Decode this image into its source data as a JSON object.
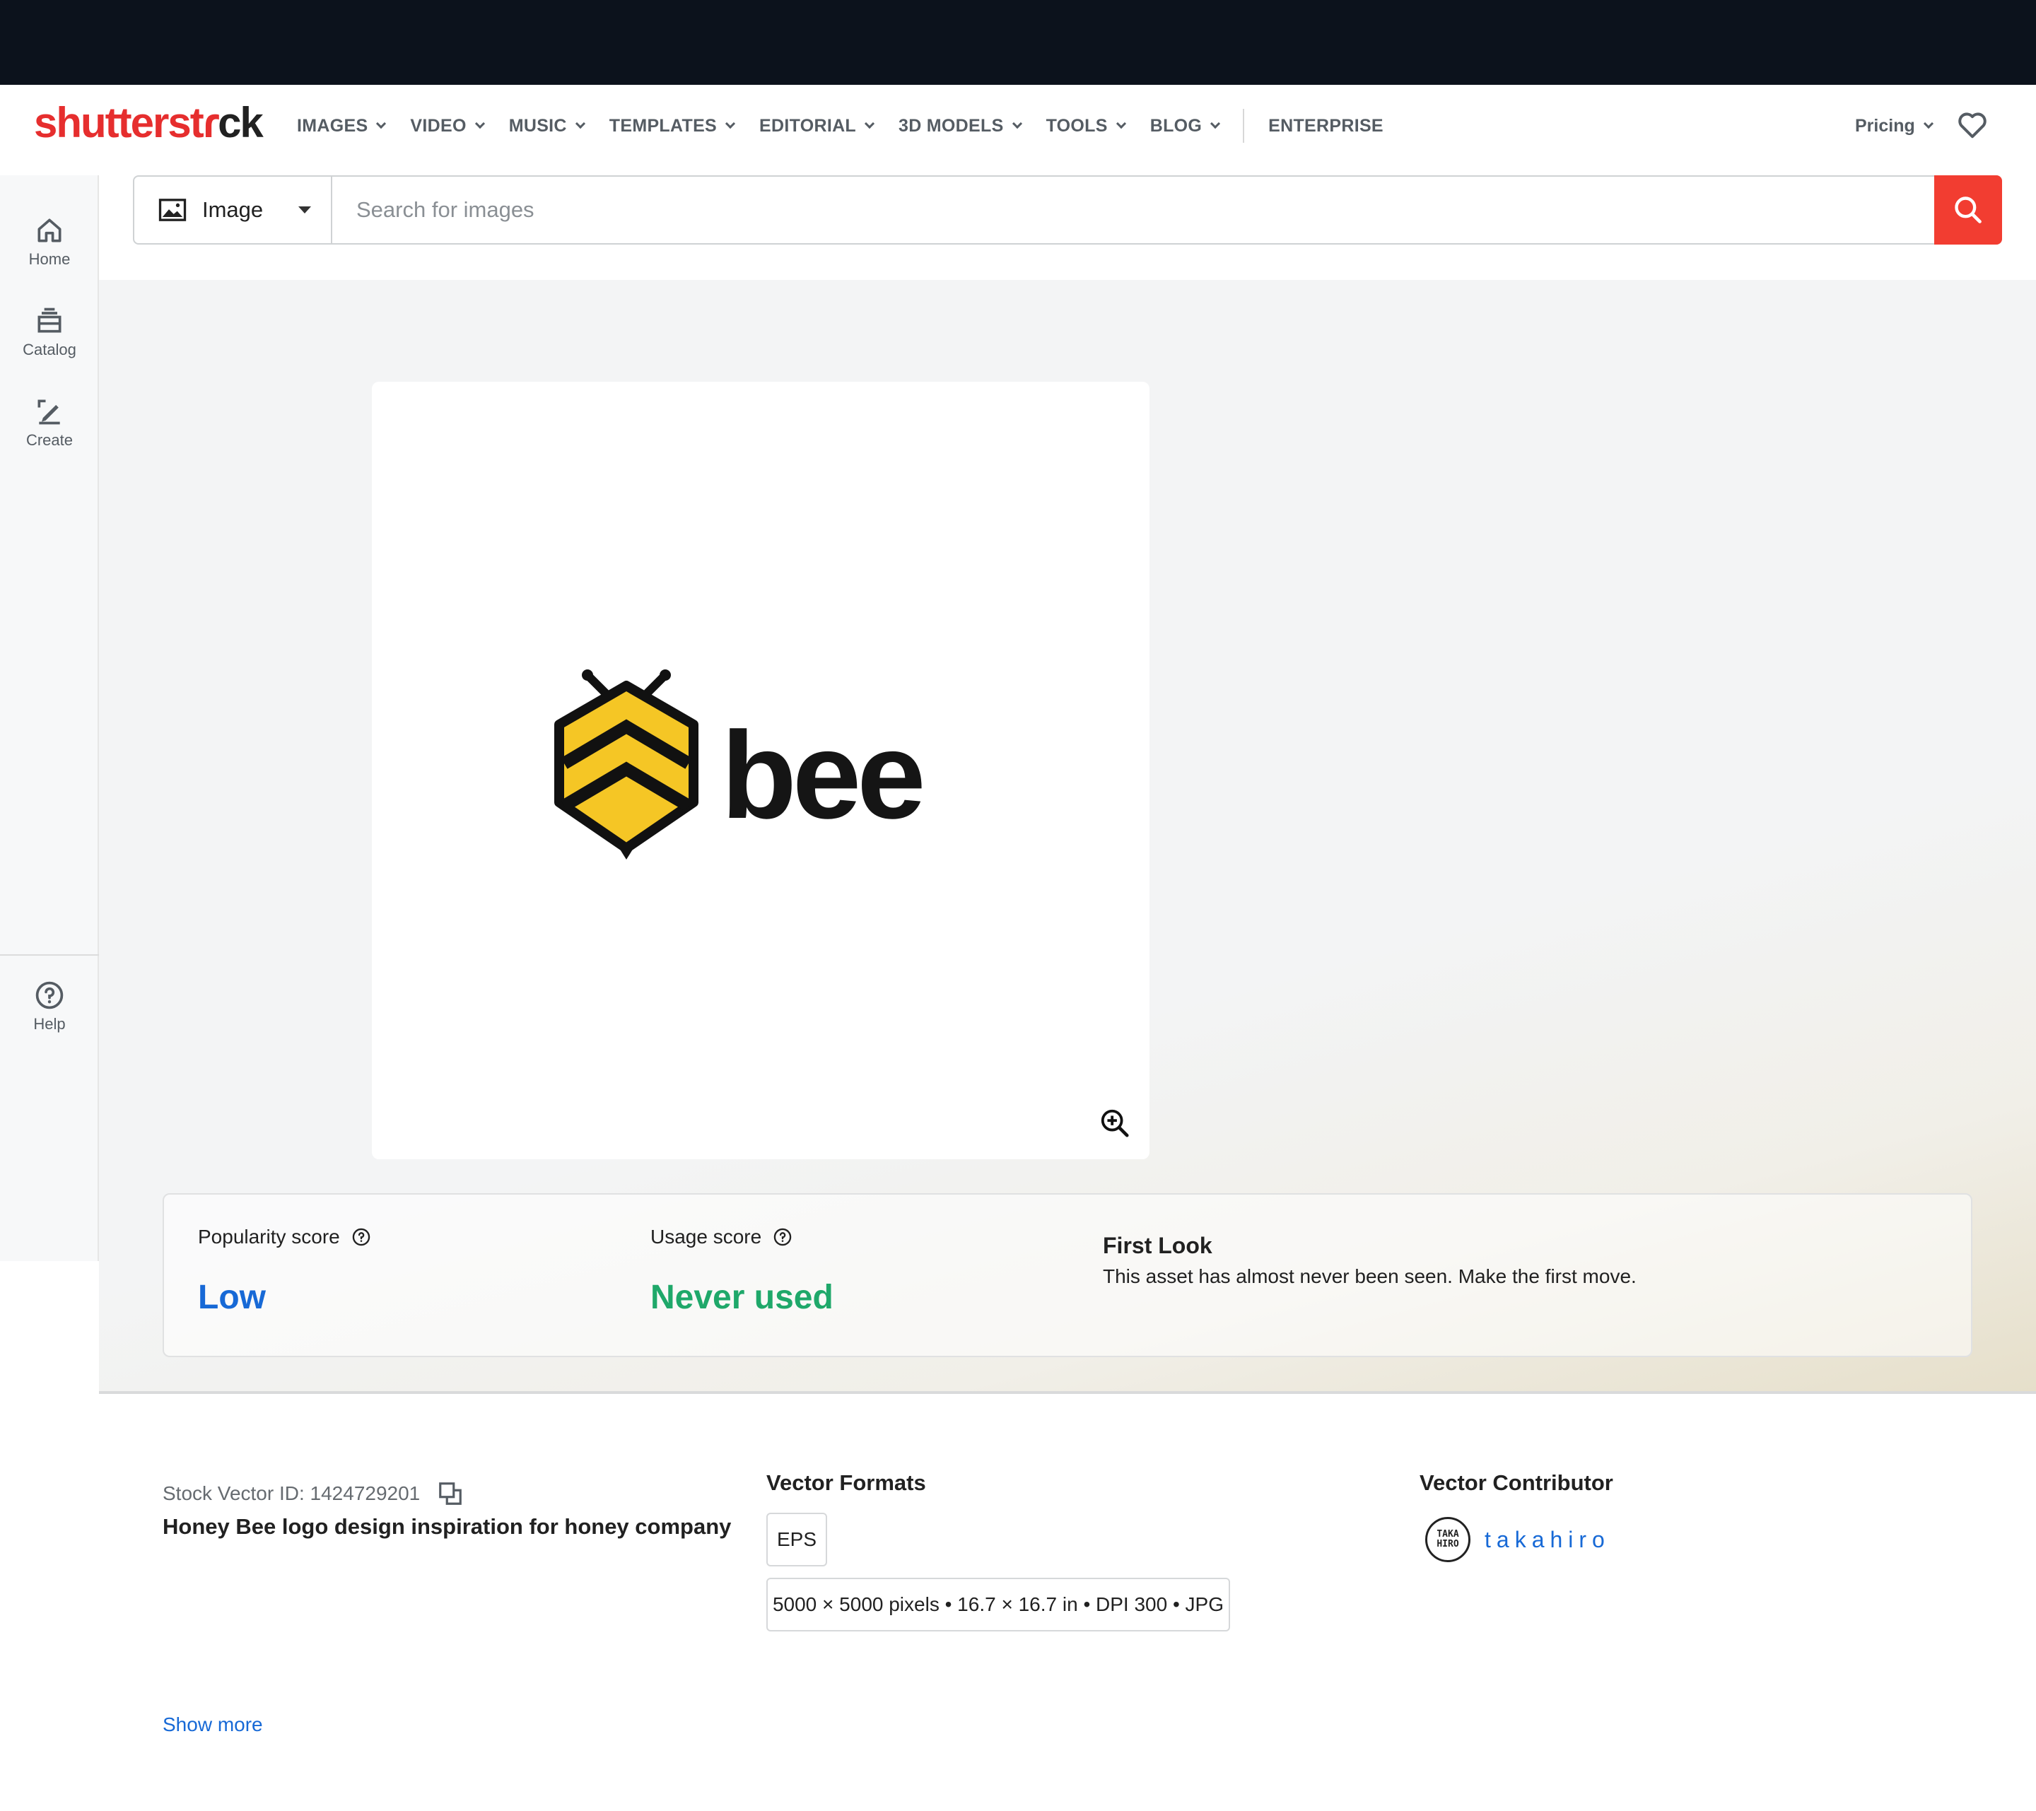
{
  "brand": {
    "logo_part1": "shutterst",
    "logo_part2": "ck",
    "accent": "#e62e2e"
  },
  "nav": {
    "items": [
      {
        "label": "IMAGES"
      },
      {
        "label": "VIDEO"
      },
      {
        "label": "MUSIC"
      },
      {
        "label": "TEMPLATES"
      },
      {
        "label": "EDITORIAL"
      },
      {
        "label": "3D MODELS"
      },
      {
        "label": "TOOLS"
      },
      {
        "label": "BLOG"
      }
    ],
    "enterprise": "ENTERPRISE",
    "pricing": "Pricing"
  },
  "sidebar": {
    "items": [
      {
        "label": "Home",
        "icon": "home-icon"
      },
      {
        "label": "Catalog",
        "icon": "catalog-icon"
      },
      {
        "label": "Create",
        "icon": "create-icon"
      }
    ],
    "help": {
      "label": "Help",
      "icon": "help-icon"
    }
  },
  "search": {
    "type_label": "Image",
    "placeholder": "Search for images",
    "button_color": "#f23d31"
  },
  "preview": {
    "logo_text": "bee"
  },
  "scores": {
    "popularity_label": "Popularity score",
    "popularity_value": "Low",
    "popularity_color": "#1769d6",
    "usage_label": "Usage score",
    "usage_value": "Never used",
    "usage_color": "#1fa86a",
    "first_look_title": "First Look",
    "first_look_text": "This asset has almost never been seen. Make the first move."
  },
  "asset": {
    "id_label": "Stock Vector ID: 1424729201",
    "title": "Honey Bee logo design inspiration for honey company"
  },
  "formats": {
    "heading": "Vector Formats",
    "eps": "EPS",
    "jpg_spec": "5000 × 5000 pixels • 16.7 × 16.7 in • DPI 300 • JPG"
  },
  "contributor": {
    "heading": "Vector Contributor",
    "avatar_text": "TAKA HIRO",
    "name": "takahiro"
  },
  "show_more": "Show more"
}
